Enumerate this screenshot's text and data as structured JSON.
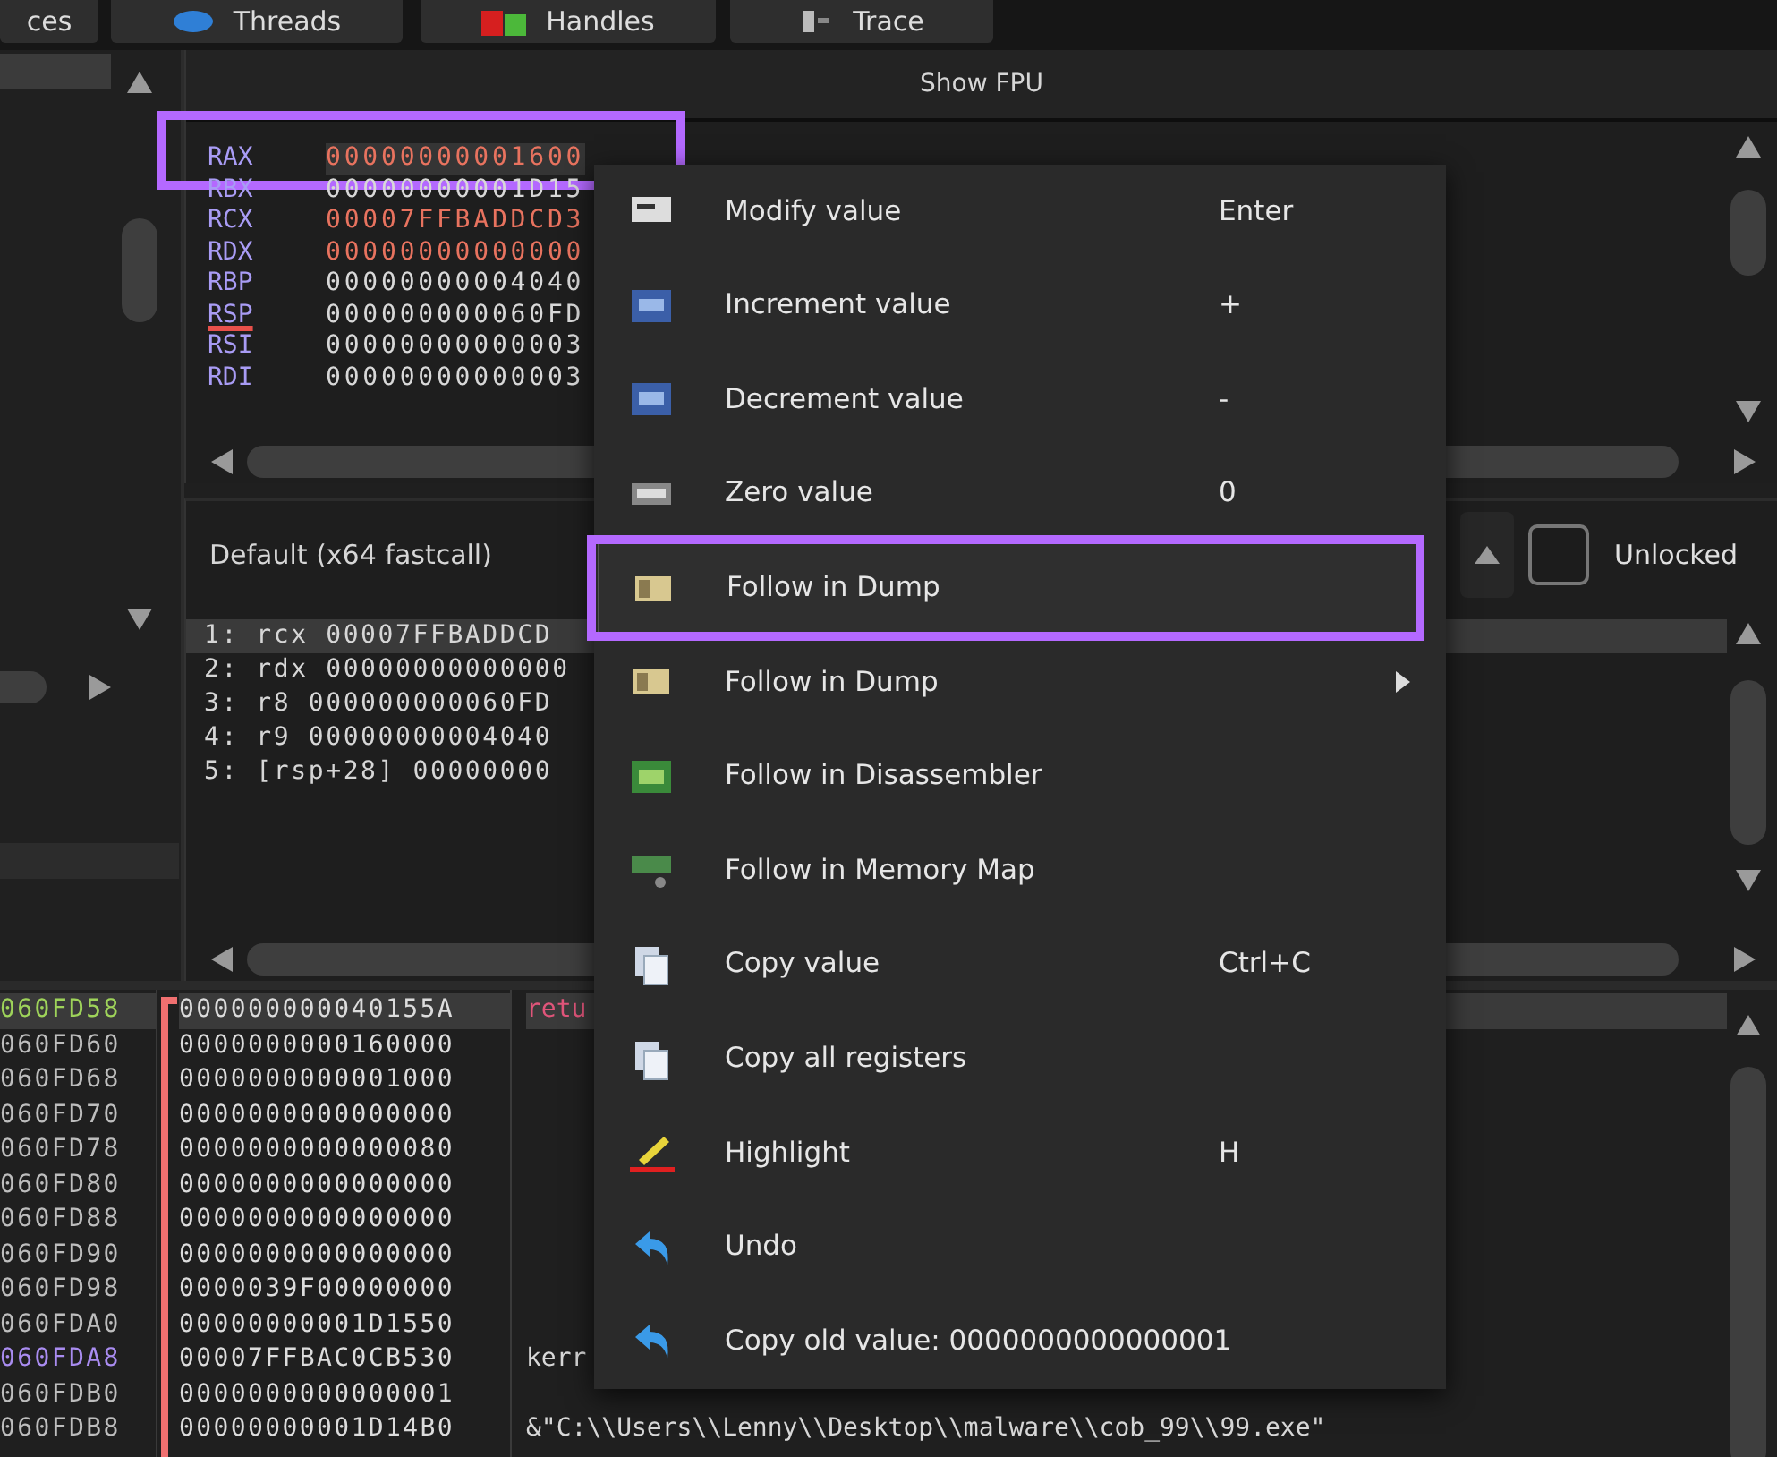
{
  "tabs": [
    {
      "label": "ces",
      "kind": "plain"
    },
    {
      "label": "Threads",
      "kind": "threads"
    },
    {
      "label": "Handles",
      "kind": "handles"
    },
    {
      "label": "Trace",
      "kind": "trace"
    }
  ],
  "registers_panel": {
    "fpu_button": "Show FPU",
    "registers": [
      {
        "name": "RAX",
        "value": "00000000001600",
        "modified": true,
        "stack_pointer": false,
        "framed": true
      },
      {
        "name": "RBX",
        "value": "00000000001D15",
        "modified": false,
        "stack_pointer": false,
        "framed": false
      },
      {
        "name": "RCX",
        "value": "00007FFBADDCD3",
        "modified": true,
        "stack_pointer": false,
        "framed": false
      },
      {
        "name": "RDX",
        "value": "00000000000000",
        "modified": true,
        "stack_pointer": false,
        "framed": false
      },
      {
        "name": "RBP",
        "value": "00000000004040",
        "modified": false,
        "stack_pointer": false,
        "framed": false
      },
      {
        "name": "RSP",
        "value": "000000000060FD",
        "modified": false,
        "stack_pointer": true,
        "framed": false
      },
      {
        "name": "RSI",
        "value": "00000000000003",
        "modified": false,
        "stack_pointer": false,
        "framed": false
      },
      {
        "name": "RDI",
        "value": "00000000000003",
        "modified": false,
        "stack_pointer": false,
        "framed": false
      }
    ]
  },
  "call_panel": {
    "convention": "Default (x64 fastcall)",
    "lock": {
      "label": "Unlocked",
      "checked": false
    },
    "args": [
      {
        "text": "1: rcx 00007FFBADDCD",
        "selected": true
      },
      {
        "text": "2: rdx 00000000000000",
        "selected": false
      },
      {
        "text": "3: r8 000000000060FD",
        "selected": false
      },
      {
        "text": "4: r9 00000000004040",
        "selected": false
      },
      {
        "text": "5: [rsp+28] 00000000",
        "selected": false
      }
    ]
  },
  "stack": {
    "rows": [
      {
        "address": "060FD58",
        "value": "000000000040155A",
        "comment": {
          "text": "retu",
          "color": "#e0557a"
        },
        "color": "#9ed35a",
        "selected": true
      },
      {
        "address": "060FD60",
        "value": "0000000000160000",
        "color": "#bdbdbd",
        "selected": false
      },
      {
        "address": "060FD68",
        "value": "0000000000001000",
        "color": "#bdbdbd",
        "selected": false
      },
      {
        "address": "060FD70",
        "value": "0000000000000000",
        "color": "#bdbdbd",
        "selected": false
      },
      {
        "address": "060FD78",
        "value": "0000000000000080",
        "color": "#bdbdbd",
        "selected": false
      },
      {
        "address": "060FD80",
        "value": "0000000000000000",
        "color": "#bdbdbd",
        "selected": false
      },
      {
        "address": "060FD88",
        "value": "0000000000000000",
        "color": "#bdbdbd",
        "selected": false
      },
      {
        "address": "060FD90",
        "value": "0000000000000000",
        "color": "#bdbdbd",
        "selected": false
      },
      {
        "address": "060FD98",
        "value": "0000039F00000000",
        "color": "#bdbdbd",
        "selected": false
      },
      {
        "address": "060FDA0",
        "value": "00000000001D1550",
        "color": "#bdbdbd",
        "selected": false
      },
      {
        "address": "060FDA8",
        "value": "00007FFBAC0CB530",
        "comment": {
          "text": "kerr",
          "color": "#d8d8d8"
        },
        "color": "#a98cf0",
        "selected": false
      },
      {
        "address": "060FDB0",
        "value": "0000000000000001",
        "color": "#bdbdbd",
        "selected": false
      },
      {
        "address": "060FDB8",
        "value": "00000000001D14B0",
        "comment": {
          "text": "&\"C:\\\\Users\\\\Lenny\\\\Desktop\\\\malware\\\\cob_99\\\\99.exe\"",
          "color": "#d8d8d8"
        },
        "color": "#bdbdbd",
        "selected": false
      }
    ]
  },
  "context_menu": {
    "items": [
      {
        "label": "Modify value",
        "shortcut": "Enter",
        "kind": "edit",
        "submenu": false,
        "selected": false,
        "framed": false
      },
      {
        "label": "Increment value",
        "shortcut": "+",
        "kind": "chip-blue",
        "submenu": false,
        "selected": false,
        "framed": false
      },
      {
        "label": "Decrement value",
        "shortcut": "-",
        "kind": "chip-blue",
        "submenu": false,
        "selected": false,
        "framed": false
      },
      {
        "label": "Zero value",
        "shortcut": "0",
        "kind": "chip-grey",
        "submenu": false,
        "selected": false,
        "framed": false
      },
      {
        "label": "Follow in Dump",
        "kind": "dump",
        "submenu": false,
        "selected": true,
        "framed": true
      },
      {
        "label": "Follow in Dump",
        "kind": "dump",
        "submenu": true,
        "selected": false,
        "framed": false
      },
      {
        "label": "Follow in Disassembler",
        "kind": "chip-green",
        "submenu": false,
        "selected": false,
        "framed": false
      },
      {
        "label": "Follow in Memory Map",
        "kind": "memmap",
        "submenu": false,
        "selected": false,
        "framed": false
      },
      {
        "label": "Copy value",
        "shortcut": "Ctrl+C",
        "kind": "copy",
        "submenu": false,
        "selected": false,
        "framed": false
      },
      {
        "label": "Copy all registers",
        "kind": "copy",
        "submenu": false,
        "selected": false,
        "framed": false
      },
      {
        "label": "Highlight",
        "shortcut": "H",
        "kind": "highlight",
        "submenu": false,
        "selected": false,
        "framed": false
      },
      {
        "label": "Undo",
        "kind": "undo",
        "submenu": false,
        "selected": false,
        "framed": false
      },
      {
        "label": "Copy old value: 0000000000000001",
        "kind": "undo",
        "submenu": false,
        "selected": false,
        "framed": false
      }
    ]
  }
}
